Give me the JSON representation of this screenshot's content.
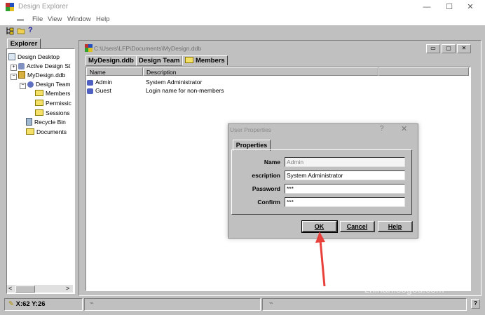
{
  "app": {
    "title": "Design Explorer",
    "controls": {
      "minimize": "—",
      "maximize": "☐",
      "close": "✕"
    }
  },
  "menu": [
    "File",
    "View",
    "Window",
    "Help"
  ],
  "toolbar": {
    "help_label": "?"
  },
  "explorer": {
    "tab": "Explorer",
    "tree": [
      "Design Desktop",
      "Active Design St",
      "MyDesign.ddb",
      "Design Team",
      "Members",
      "Permissic",
      "Sessions",
      "Recycle Bin",
      "Documents"
    ],
    "scroll_left": "<",
    "scroll_right": ">"
  },
  "document": {
    "path": "C:\\Users\\LFP\\Documents\\MyDesign.ddb",
    "tabs": [
      "MyDesign.ddb",
      "Design Team",
      "Members"
    ],
    "columns": [
      "Name",
      "Description"
    ],
    "rows": [
      {
        "name": "Admin",
        "description": "System Administrator"
      },
      {
        "name": "Guest",
        "description": "Login name for non-members"
      }
    ]
  },
  "dialog": {
    "title": "User Properties",
    "help": "?",
    "close": "✕",
    "tab": "Properties",
    "fields": [
      {
        "label": "Name",
        "value": "Admin"
      },
      {
        "label": "escription",
        "value": "System Administrator"
      },
      {
        "label": "Password",
        "value": "***"
      },
      {
        "label": "Confirm",
        "value": "***"
      }
    ],
    "buttons": {
      "ok": "OK",
      "cancel": "Cancel",
      "help": "Help"
    }
  },
  "status": {
    "coords": "X:62 Y:26",
    "help_icon": "?"
  },
  "watermark": {
    "text": "搜狗指南",
    "url": "zhinan.sogou.com",
    "logo": "S"
  },
  "colors": {
    "arrow": "#e8413c",
    "window_bg": "#c0c0c0"
  }
}
